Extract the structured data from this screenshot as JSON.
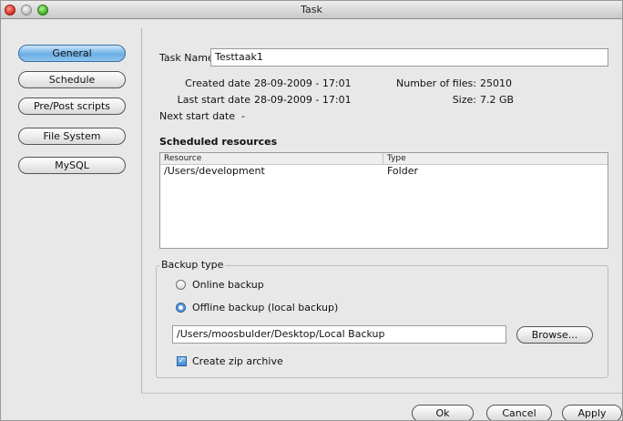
{
  "window": {
    "title": "Task"
  },
  "sidebar": {
    "items": [
      {
        "label": "General",
        "active": true
      },
      {
        "label": "Schedule",
        "active": false
      },
      {
        "label": "Pre/Post scripts",
        "active": false
      },
      {
        "label": "File System",
        "active": false
      },
      {
        "label": "MySQL",
        "active": false
      }
    ]
  },
  "form": {
    "task_name_label": "Task Name",
    "task_name_value": "Testtaak1",
    "created_label": "Created date",
    "created_value": "28-09-2009 - 17:01",
    "last_start_label": "Last start date",
    "last_start_value": "28-09-2009 - 17:01",
    "next_start_label": "Next start date",
    "next_start_value": "-",
    "files_label": "Number of files:",
    "files_value": "25010",
    "size_label": "Size:",
    "size_value": "7.2 GB"
  },
  "resources": {
    "heading": "Scheduled resources",
    "columns": [
      "Resource",
      "Type"
    ],
    "rows": [
      {
        "resource": "/Users/development",
        "type": "Folder"
      }
    ]
  },
  "backup": {
    "legend": "Backup type",
    "options": [
      {
        "label": "Online backup",
        "selected": false
      },
      {
        "label": "Offline backup (local backup)",
        "selected": true
      }
    ],
    "path_value": "/Users/moosbulder/Desktop/Local Backup",
    "browse_label": "Browse...",
    "zip_label": "Create zip archive",
    "zip_checked": true
  },
  "footer": {
    "ok_label": "Ok",
    "cancel_label": "Cancel",
    "apply_label": "Apply"
  },
  "colors": {
    "active_button": "#6aaee6",
    "window_bg": "#e8e8e8"
  },
  "icons": {
    "window_controls": [
      "close-icon",
      "minimize-icon",
      "zoom-icon"
    ],
    "check": "checkmark-icon"
  }
}
